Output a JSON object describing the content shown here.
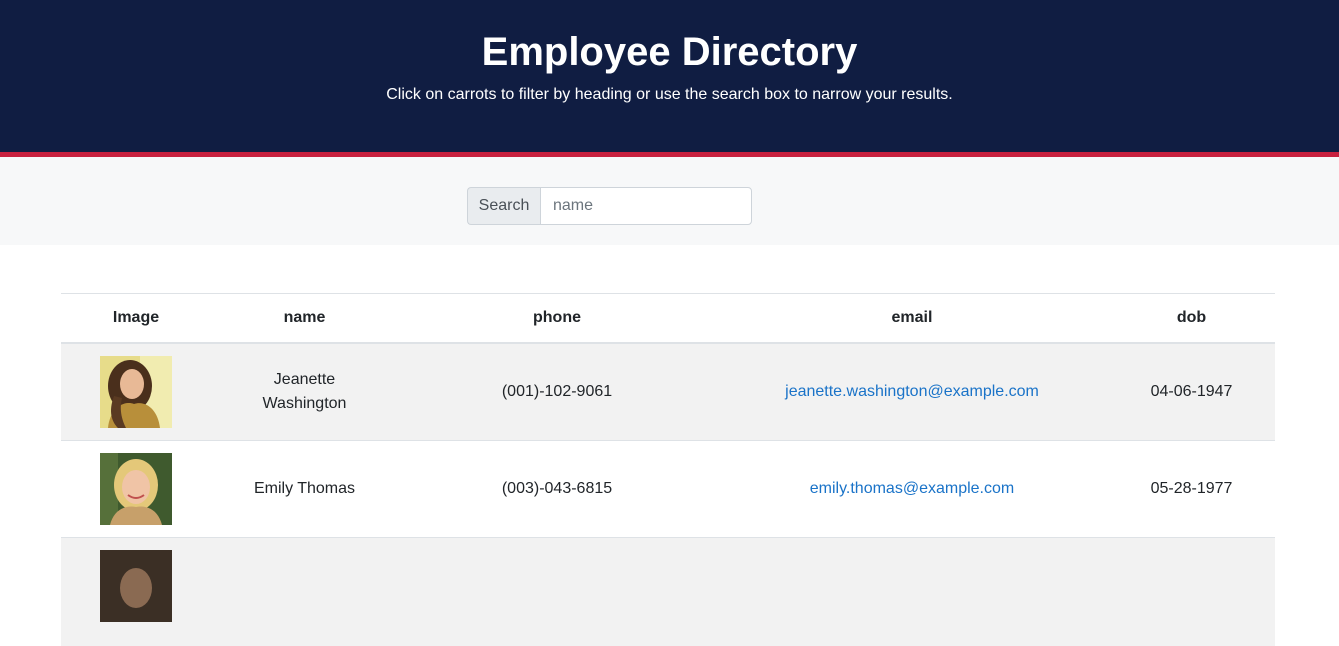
{
  "header": {
    "title": "Employee Directory",
    "subtitle": "Click on carrots to filter by heading or use the search box to narrow your results."
  },
  "search": {
    "label": "Search",
    "placeholder": "name",
    "value": ""
  },
  "table": {
    "columns": [
      "Image",
      "name",
      "phone",
      "email",
      "dob"
    ],
    "rows": [
      {
        "name": "Jeanette Washington",
        "phone": "(001)-102-9061",
        "email": "jeanette.washington@example.com",
        "dob": "04-06-1947"
      },
      {
        "name": "Emily Thomas",
        "phone": "(003)-043-6815",
        "email": "emily.thomas@example.com",
        "dob": "05-28-1977"
      },
      {
        "name": "",
        "phone": "",
        "email": "",
        "dob": ""
      }
    ]
  },
  "colors": {
    "header_bg": "#101d42",
    "accent": "#c8203f",
    "link": "#1a73c8",
    "row_stripe": "#f2f2f2"
  }
}
